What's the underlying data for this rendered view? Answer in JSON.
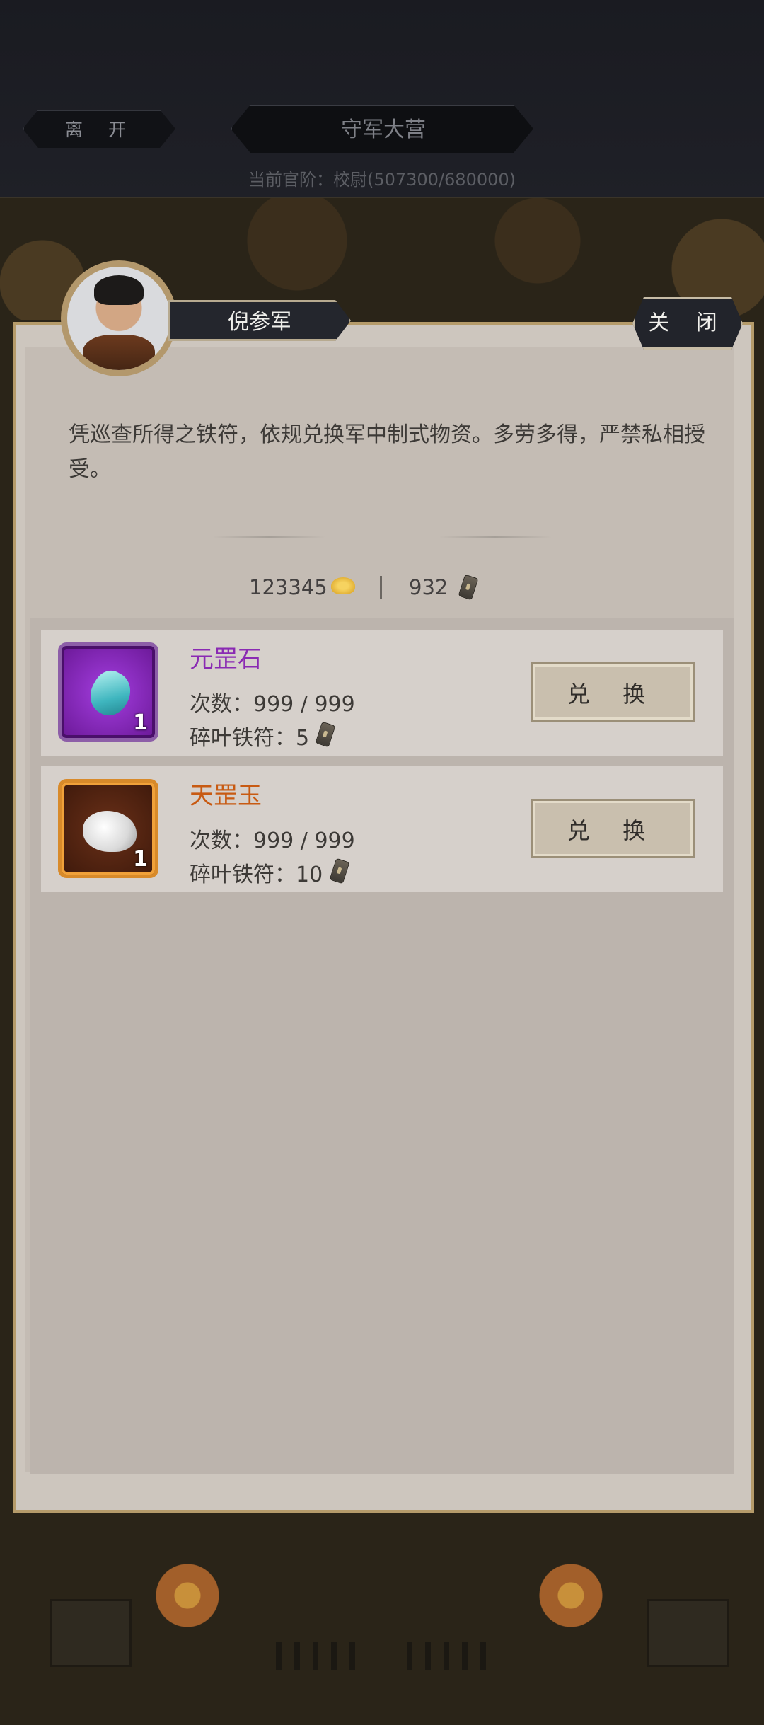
{
  "topbar": {
    "leave_label": "离 开",
    "title": "守军大营",
    "rank_text": "当前官阶：校尉(507300/680000)"
  },
  "panel": {
    "npc_name": "倪参军",
    "close_label": "关 闭",
    "description": "凭巡查所得之铁符，依规兑换军中制式物资。多劳多得，严禁私相授受。",
    "currency": {
      "ingot_amount": "123345",
      "token_amount": "932",
      "ingot_icon": "gold-ingot-icon",
      "token_icon": "iron-token-icon"
    }
  },
  "items": [
    {
      "name": "元罡石",
      "quantity": "1",
      "count_line": "次数：999 / 999",
      "cost_line": "碎叶铁符：5",
      "button_label": "兑 换",
      "rarity_color": "#8a2ab3",
      "icon": "blue-gem-icon"
    },
    {
      "name": "天罡玉",
      "quantity": "1",
      "count_line": "次数：999 / 999",
      "cost_line": "碎叶铁符：10",
      "button_label": "兑 换",
      "rarity_color": "#c85a12",
      "icon": "white-jade-icon"
    }
  ]
}
